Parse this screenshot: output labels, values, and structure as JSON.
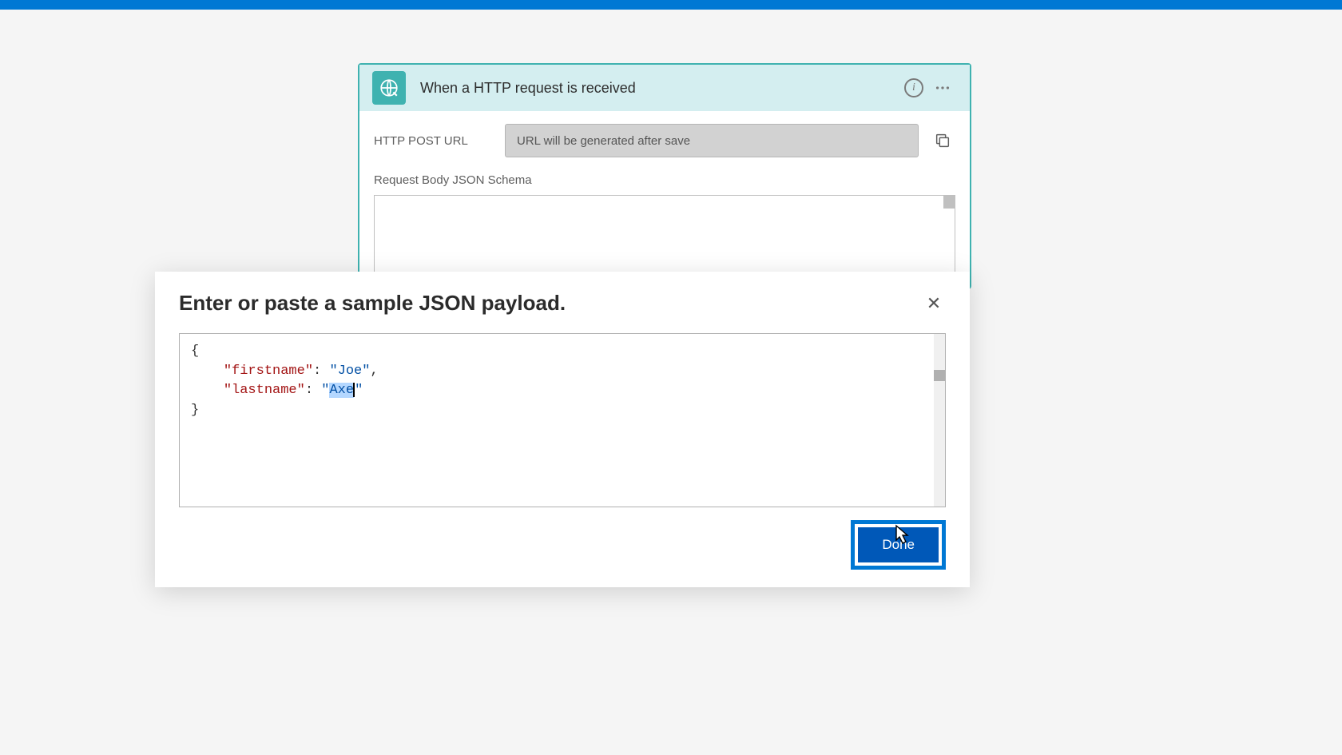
{
  "trigger": {
    "title": "When a HTTP request is received",
    "url_label": "HTTP POST URL",
    "url_placeholder": "URL will be generated after save",
    "schema_label": "Request Body JSON Schema"
  },
  "modal": {
    "title": "Enter or paste a sample JSON payload.",
    "done_label": "Done",
    "sample": {
      "brace_open": "{",
      "brace_close": "}",
      "key1": "\"firstname\"",
      "val1": "\"Joe\"",
      "comma": ",",
      "key2": "\"lastname\"",
      "colon": ": ",
      "quote": "\"",
      "val2_selected": "Axe",
      "indent": "    "
    }
  }
}
